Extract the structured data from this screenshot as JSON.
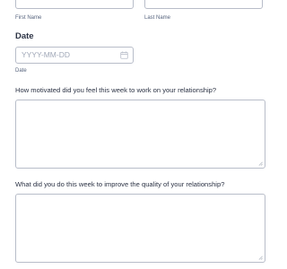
{
  "name": {
    "first_sublabel": "First Name",
    "last_sublabel": "Last Name"
  },
  "date": {
    "label": "Date",
    "placeholder": "YYYY-MM-DD",
    "sublabel": "Date",
    "icon": "calendar-icon"
  },
  "questions": [
    {
      "label": "How motivated did you feel this week to work on your relationship?",
      "value": ""
    },
    {
      "label": "What did you do this week to improve the quality of your relationship?",
      "value": ""
    }
  ],
  "colors": {
    "border": "#b8bdc9",
    "text": "#2c3345",
    "sublabel": "#57647e",
    "placeholder": "#a1a8b8"
  }
}
